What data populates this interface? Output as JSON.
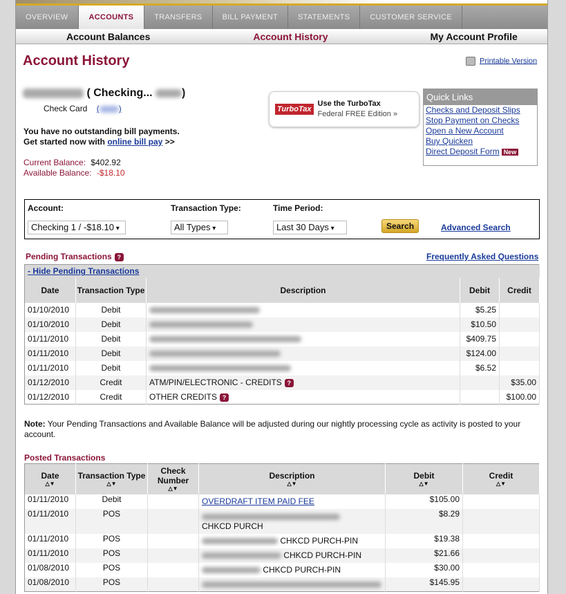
{
  "tabs": [
    "OVERVIEW",
    "ACCOUNTS",
    "TRANSFERS",
    "BILL PAYMENT",
    "STATEMENTS",
    "CUSTOMER SERVICE"
  ],
  "subnav": [
    "Account Balances",
    "Account History",
    "My Account Profile"
  ],
  "page_title": "Account History",
  "printable": "Printable Version",
  "account_label": "( Checking... ",
  "account_close": ")",
  "check_card": "Check Card",
  "bill_msg1": "You have no outstanding bill payments.",
  "bill_msg2": "Get started now with ",
  "bill_link": "online bill pay",
  "bill_arrow": " >>",
  "current_balance_label": "Current Balance:",
  "current_balance": "$402.92",
  "available_balance_label": "Available Balance:",
  "available_balance": "-$18.10",
  "turbotax": {
    "logo": "TurboTax",
    "line1": "Use the TurboTax",
    "line2": "Federal FREE Edition »"
  },
  "quick_links": {
    "title": "Quick Links",
    "items": [
      "Checks and Deposit Slips",
      "Stop Payment on Checks",
      "Open a New Account",
      "Buy Quicken",
      "Direct Deposit Form"
    ],
    "new_badge": "New"
  },
  "filter": {
    "account_label": "Account:",
    "account_value": "Checking 1 / -$18.10",
    "type_label": "Transaction Type:",
    "type_value": "All Types",
    "period_label": "Time Period:",
    "period_value": "Last 30 Days",
    "search": "Search",
    "advanced": "Advanced Search"
  },
  "pending": {
    "title": "Pending Transactions",
    "faq": "Frequently Asked Questions",
    "hide": "- Hide Pending Transactions",
    "headers": [
      "Date",
      "Transaction Type",
      "Description",
      "Debit",
      "Credit"
    ],
    "rows": [
      [
        "01/10/2010",
        "Debit",
        "",
        "$5.25",
        ""
      ],
      [
        "01/10/2010",
        "Debit",
        "",
        "$10.50",
        ""
      ],
      [
        "01/11/2010",
        "Debit",
        "",
        "$409.75",
        ""
      ],
      [
        "01/11/2010",
        "Debit",
        "",
        "$124.00",
        ""
      ],
      [
        "01/11/2010",
        "Debit",
        "",
        "$6.52",
        ""
      ],
      [
        "01/12/2010",
        "Credit",
        "ATM/PIN/ELECTRONIC - CREDITS",
        "",
        "$35.00"
      ],
      [
        "01/12/2010",
        "Credit",
        "OTHER CREDITS",
        "",
        "$100.00"
      ]
    ]
  },
  "note_label": "Note:",
  "note": " Your Pending Transactions and Available Balance will be adjusted during our nightly processing cycle as activity is posted to your account.",
  "posted": {
    "title": "Posted Transactions",
    "headers": [
      "Date",
      "Transaction Type",
      "Check Number",
      "Description",
      "Debit",
      "Credit"
    ],
    "rows": [
      [
        "01/11/2010",
        "Debit",
        "",
        "OVERDRAFT ITEM PAID FEE",
        "$105.00",
        ""
      ],
      [
        "01/11/2010",
        "POS",
        "",
        "CHKCD PURCH",
        "$8.29",
        ""
      ],
      [
        "01/11/2010",
        "POS",
        "",
        "CHKCD PURCH-PIN",
        "$19.38",
        ""
      ],
      [
        "01/11/2010",
        "POS",
        "",
        "CHKCD PURCH-PIN",
        "$21.66",
        ""
      ],
      [
        "01/08/2010",
        "POS",
        "",
        "CHKCD PURCH-PIN",
        "$30.00",
        ""
      ],
      [
        "01/08/2010",
        "POS",
        "",
        "",
        "$145.95",
        ""
      ]
    ]
  }
}
